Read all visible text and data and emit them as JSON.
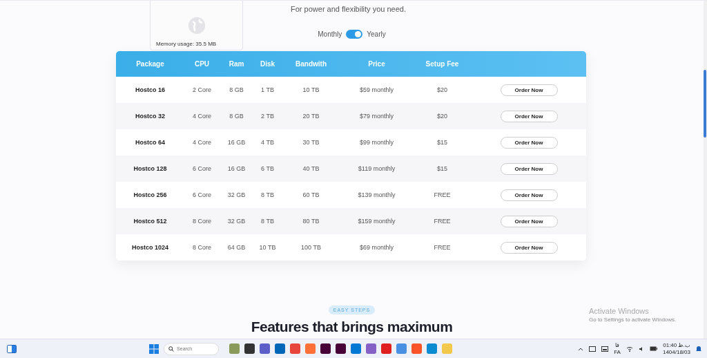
{
  "subtitle": "For power and flexibility you need.",
  "billing_toggle": {
    "left_label": "Monthly",
    "right_label": "Yearly",
    "on": true
  },
  "table": {
    "columns": [
      "Package",
      "CPU",
      "Ram",
      "Disk",
      "Bandwith",
      "Price",
      "Setup Fee"
    ],
    "rows": [
      {
        "package": "Hostco 16",
        "cpu": "2 Core",
        "ram": "8 GB",
        "disk": "1 TB",
        "bandwidth": "10 TB",
        "price": "$59 monthly",
        "setup_fee": "$20",
        "action": "Order Now"
      },
      {
        "package": "Hostco 32",
        "cpu": "4 Core",
        "ram": "8 GB",
        "disk": "2 TB",
        "bandwidth": "20 TB",
        "price": "$79 monthly",
        "setup_fee": "$20",
        "action": "Order Now"
      },
      {
        "package": "Hostco 64",
        "cpu": "4 Core",
        "ram": "16 GB",
        "disk": "4 TB",
        "bandwidth": "30 TB",
        "price": "$99 monthly",
        "setup_fee": "$15",
        "action": "Order Now"
      },
      {
        "package": "Hostco 128",
        "cpu": "6 Core",
        "ram": "16 GB",
        "disk": "6 TB",
        "bandwidth": "40 TB",
        "price": "$119 monthly",
        "setup_fee": "$15",
        "action": "Order Now"
      },
      {
        "package": "Hostco 256",
        "cpu": "6 Core",
        "ram": "32 GB",
        "disk": "8 TB",
        "bandwidth": "60 TB",
        "price": "$139 monthly",
        "setup_fee": "FREE",
        "action": "Order Now"
      },
      {
        "package": "Hostco 512",
        "cpu": "8 Core",
        "ram": "32 GB",
        "disk": "8 TB",
        "bandwidth": "80 TB",
        "price": "$159 monthly",
        "setup_fee": "FREE",
        "action": "Order Now"
      },
      {
        "package": "Hostco 1024",
        "cpu": "8 Core",
        "ram": "64 GB",
        "disk": "10 TB",
        "bandwidth": "100 TB",
        "price": "$69 monthly",
        "setup_fee": "FREE",
        "action": "Order Now"
      }
    ]
  },
  "tab_preview": {
    "memory_usage": "Memory usage: 35.5 MB"
  },
  "section": {
    "badge": "EASY STEPS",
    "title": "Features that brings maximum"
  },
  "activation_notice": {
    "title": "Activate Windows",
    "subtitle": "Go to Settings to activate Windows."
  },
  "taskbar": {
    "search_placeholder": "Search",
    "language_script": "فا",
    "language": "FA",
    "time": "01:40 ب.ظ",
    "date": "1404/18/03"
  }
}
